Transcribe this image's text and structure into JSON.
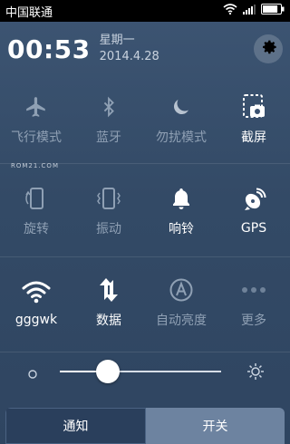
{
  "status": {
    "carrier": "中国联通",
    "battery_level": 0.85
  },
  "header": {
    "time": "00:53",
    "weekday": "星期一",
    "date": "2014.4.28"
  },
  "watermark": "ROM21.COM",
  "toggles_row1": [
    {
      "label": "飞行模式",
      "icon": "airplane-icon",
      "on": false
    },
    {
      "label": "蓝牙",
      "icon": "bluetooth-icon",
      "on": false
    },
    {
      "label": "勿扰模式",
      "icon": "moon-icon",
      "on": false
    },
    {
      "label": "截屏",
      "icon": "screenshot-icon",
      "on": true
    }
  ],
  "toggles_row2": [
    {
      "label": "旋转",
      "icon": "rotate-icon",
      "on": false
    },
    {
      "label": "振动",
      "icon": "vibrate-icon",
      "on": false
    },
    {
      "label": "响铃",
      "icon": "bell-icon",
      "on": true
    },
    {
      "label": "GPS",
      "icon": "gps-icon",
      "on": true
    }
  ],
  "toggles_row3": [
    {
      "label": "gggwk",
      "icon": "wifi-icon",
      "on": true
    },
    {
      "label": "数据",
      "icon": "data-icon",
      "on": true
    },
    {
      "label": "自动亮度",
      "icon": "auto-brightness-icon",
      "on": false
    },
    {
      "label": "更多",
      "icon": "more-icon",
      "on": false
    }
  ],
  "brightness": {
    "level": 0.3
  },
  "tabs": {
    "notifications": "通知",
    "toggles": "开关"
  },
  "colors": {
    "on": "#ffffff",
    "off": "#8fa0b4",
    "status_bar": "#000000"
  }
}
